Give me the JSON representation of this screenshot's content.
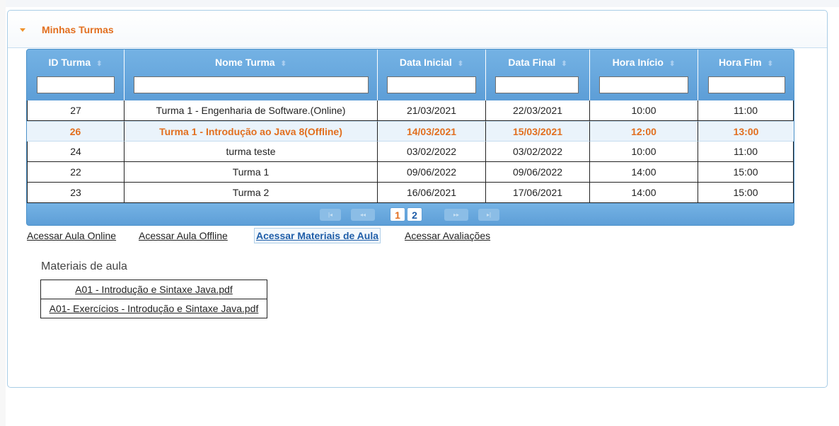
{
  "panel": {
    "title": "Minhas Turmas"
  },
  "table": {
    "columns": [
      {
        "label": "ID Turma"
      },
      {
        "label": "Nome Turma"
      },
      {
        "label": "Data Inicial"
      },
      {
        "label": "Data Final"
      },
      {
        "label": "Hora Início"
      },
      {
        "label": "Hora Fim"
      }
    ],
    "rows": [
      {
        "id": "27",
        "nome": "Turma 1 - Engenharia de Software.(Online)",
        "data_inicial": "21/03/2021",
        "data_final": "22/03/2021",
        "hora_inicio": "10:00",
        "hora_fim": "11:00",
        "selected": false
      },
      {
        "id": "26",
        "nome": "Turma 1 - Introdução ao Java 8(Offline)",
        "data_inicial": "14/03/2021",
        "data_final": "15/03/2021",
        "hora_inicio": "12:00",
        "hora_fim": "13:00",
        "selected": true
      },
      {
        "id": "24",
        "nome": "turma teste",
        "data_inicial": "03/02/2022",
        "data_final": "03/02/2022",
        "hora_inicio": "10:00",
        "hora_fim": "11:00",
        "selected": false
      },
      {
        "id": "22",
        "nome": "Turma 1",
        "data_inicial": "09/06/2022",
        "data_final": "09/06/2022",
        "hora_inicio": "14:00",
        "hora_fim": "15:00",
        "selected": false
      },
      {
        "id": "23",
        "nome": "Turma 2",
        "data_inicial": "16/06/2021",
        "data_final": "17/06/2021",
        "hora_inicio": "14:00",
        "hora_fim": "15:00",
        "selected": false
      }
    ]
  },
  "paginator": {
    "first_icon": "first-page-icon",
    "prev_icon": "previous-page-icon",
    "next_icon": "next-page-icon",
    "last_icon": "last-page-icon",
    "pages": [
      "1",
      "2"
    ],
    "current_page": "1"
  },
  "tabs": [
    {
      "label": "Acessar Aula Online",
      "active": false
    },
    {
      "label": "Acessar Aula Offline",
      "active": false
    },
    {
      "label": "Acessar Materiais de Aula",
      "active": true
    },
    {
      "label": "Acessar Avaliações",
      "active": false
    }
  ],
  "materials": {
    "title": "Materiais de aula",
    "items": [
      "A01 - Introdução e Sintaxe Java.pdf",
      "A01- Exercícios - Introdução e Sintaxe Java.pdf"
    ]
  },
  "colors": {
    "accent": "#e26f1f",
    "header_blue": "#6aa8dc",
    "link_blue": "#1e5da8"
  }
}
